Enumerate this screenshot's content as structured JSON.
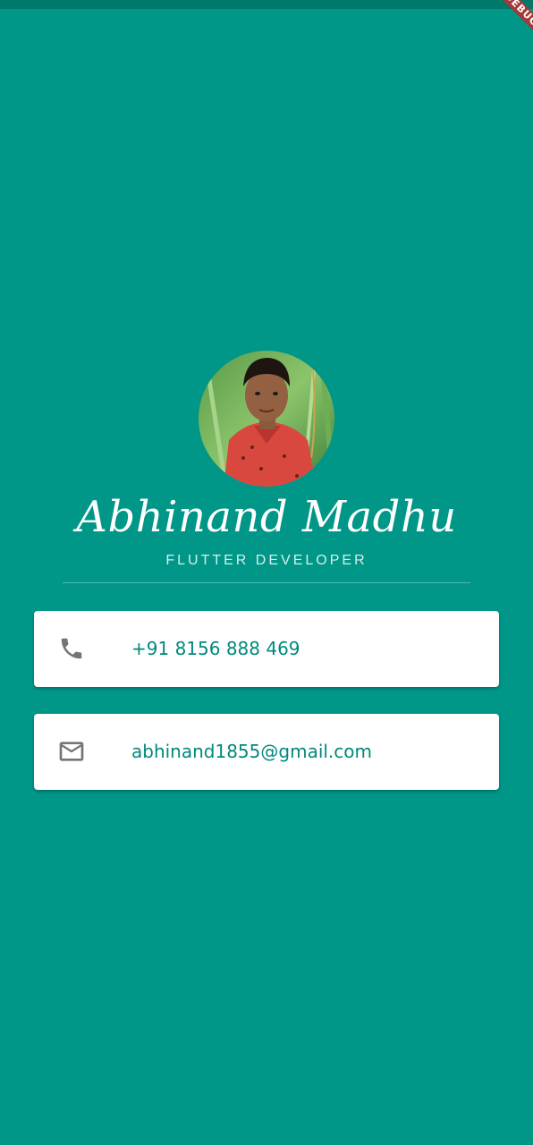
{
  "banner": {
    "label": "DEBUG"
  },
  "profile": {
    "name": "Abhinand Madhu",
    "role": "FLUTTER DEVELOPER"
  },
  "contacts": {
    "phone": {
      "icon": "phone-icon",
      "value": "+91 8156 888 469"
    },
    "email": {
      "icon": "mail-icon",
      "value": "abhinand1855@gmail.com"
    }
  },
  "colors": {
    "background": "#009688",
    "status_bar": "#00796b",
    "card": "#ffffff",
    "accent_text": "#00897b",
    "icon": "#757575",
    "debug_ribbon": "#a33a3a"
  }
}
